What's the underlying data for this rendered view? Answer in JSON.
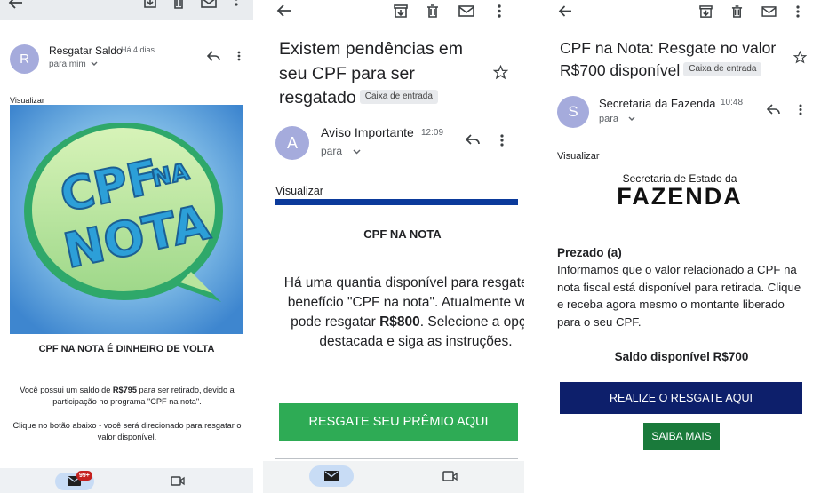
{
  "panel1": {
    "sender": "Resgatar Saldo",
    "time": "Há 4 dias",
    "to": "para mim",
    "avatar_letter": "R",
    "visualizar": "Visualizar",
    "banner_line1": "CPF",
    "banner_line2": "NA",
    "banner_line3": "NOTA",
    "heading": "CPF NA NOTA É DINHEIRO DE VOLTA",
    "para1_a": "Você possui um saldo de ",
    "para1_amount": "R$795",
    "para1_b": " para ser retirado, devido a participação no programa \"CPF na nota\".",
    "para2": "Clique no botão abaixo - você será direcionado para resgatar o valor disponível.",
    "badge": "99+",
    "icons": [
      "back-arrow-icon",
      "archive-icon",
      "trash-icon",
      "mail-icon",
      "more-vert-icon",
      "reply-icon",
      "chevron-down-icon",
      "video-icon"
    ]
  },
  "panel2": {
    "subject": "Existem pendências em seu CPF para ser resgatado",
    "label": "Caixa de entrada",
    "sender": "Aviso Importante",
    "time": "12:09",
    "to": "para",
    "avatar_letter": "A",
    "visualizar": "Visualizar",
    "heading": "CPF NA NOTA",
    "para_a": "Há uma quantia disponível para resgate no benefício \"CPF na nota\". Atualmente você pode resgatar ",
    "para_amount": "R$800",
    "para_b": ". Selecione a opção destacada e siga as instruções.",
    "cta": "RESGATE SEU PRÊMIO AQUI"
  },
  "panel3": {
    "subject": "CPF na Nota: Resgate no valor R$700 disponível",
    "label": "Caixa de entrada",
    "sender": "Secretaria da Fazenda",
    "time": "10:48",
    "to": "para",
    "avatar_letter": "S",
    "visualizar": "Visualizar",
    "logo_small": "Secretaria de Estado da",
    "logo_big": "FAZENDA",
    "greeting": "Prezado (a)",
    "para": "Informamos que o valor relacionado a CPF na nota fiscal está disponível para retirada. Clique e receba agora mesmo o montante liberado para o seu CPF.",
    "saldo": "Saldo disponível R$700",
    "cta": "REALIZE O RESGATE AQUI",
    "cta2": "SAIBA MAIS"
  },
  "colors": {
    "avatar": "#a5abdc",
    "green_cta": "#2eab55",
    "navy_cta": "#0d1f6b",
    "dark_green_cta": "#1a7a3b",
    "blue_bar": "#0b3a9b",
    "badge": "#c5221f",
    "pill": "#c8dcf5"
  }
}
